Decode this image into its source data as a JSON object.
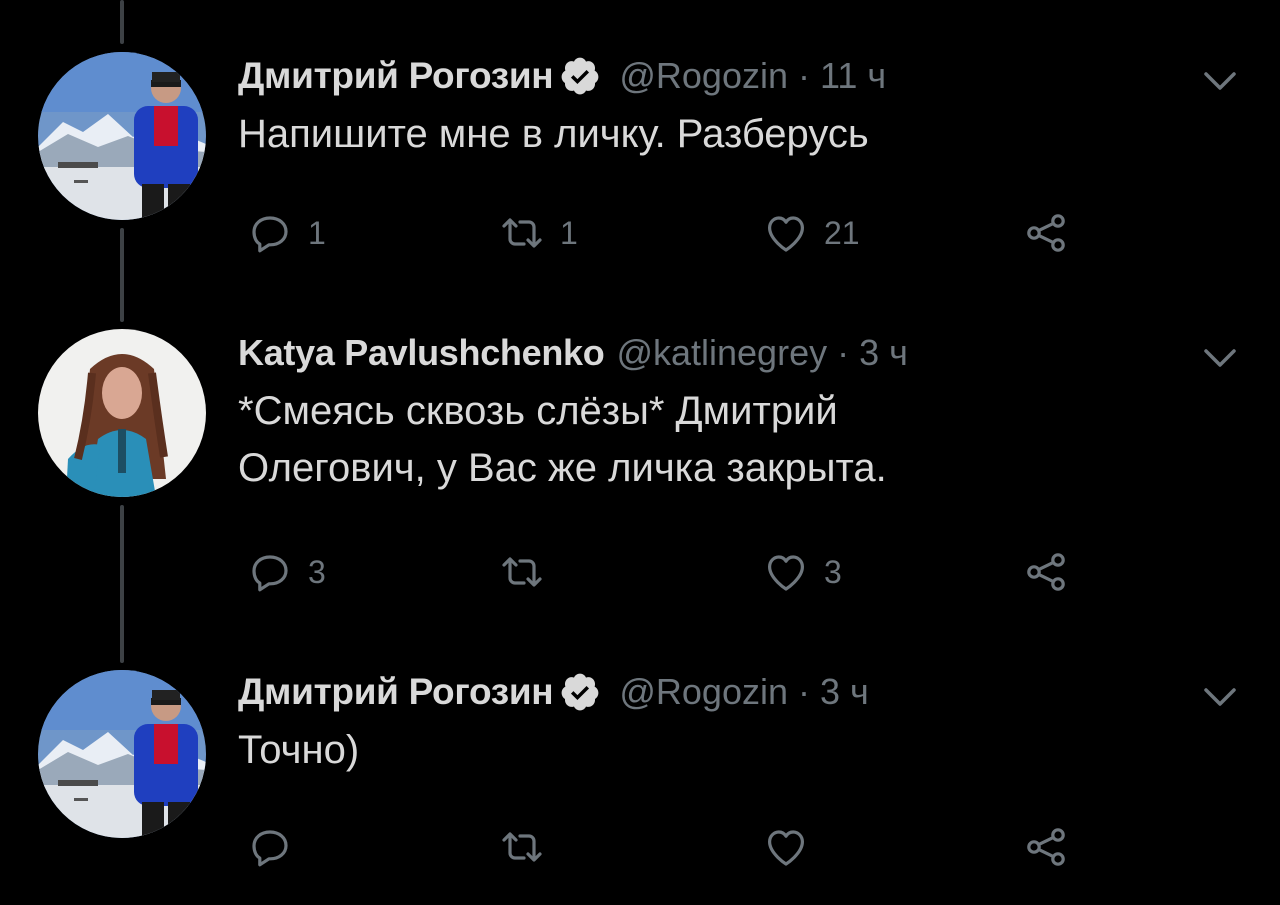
{
  "colors": {
    "background": "#000000",
    "text": "#d9d9d9",
    "muted": "#6e767d",
    "thread_line": "#3d4145",
    "verified_badge": "#d9d9d9"
  },
  "tweets": [
    {
      "name": "Дмитрий Рогозин",
      "verified": true,
      "handle": "@Rogozin",
      "separator": "·",
      "time": "11 ч",
      "text_lines": [
        "Напишите мне в личку. Разберусь"
      ],
      "replies": "1",
      "retweets": "1",
      "likes": "21",
      "avatar": "rogozin-avatar"
    },
    {
      "name": "Katya Pavlushchenko",
      "verified": false,
      "handle": "@katlinegrey",
      "separator": "·",
      "time": "3 ч",
      "text_lines": [
        "*Смеясь сквозь слёзы* Дмитрий",
        "Олегович, у Вас же личка закрыта."
      ],
      "replies": "3",
      "retweets": "",
      "likes": "3",
      "avatar": "katya-avatar"
    },
    {
      "name": "Дмитрий Рогозин",
      "verified": true,
      "handle": "@Rogozin",
      "separator": "·",
      "time": "3 ч",
      "text_lines": [
        "Точно)"
      ],
      "replies": "",
      "retweets": "",
      "likes": "",
      "avatar": "rogozin-avatar"
    }
  ],
  "icons": {
    "reply": "reply-icon",
    "retweet": "retweet-icon",
    "like": "heart-icon",
    "share": "share-icon",
    "more": "chevron-down-icon",
    "verified": "verified-badge-icon"
  }
}
